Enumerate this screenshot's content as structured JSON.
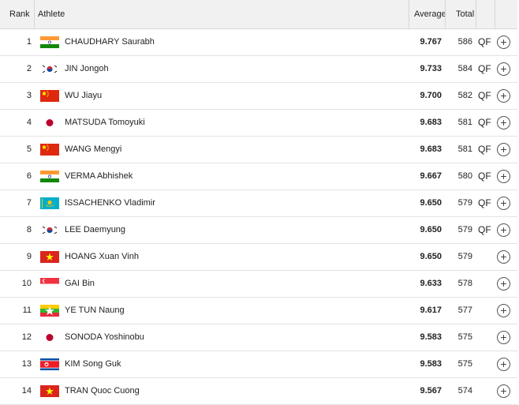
{
  "headers": {
    "rank": "Rank",
    "athlete": "Athlete",
    "average": "Average",
    "total": "Total"
  },
  "flag_colors": {
    "IND": [
      "#FF9933",
      "#FFFFFF",
      "#138808"
    ],
    "KOR": [
      "#FFFFFF",
      "#CD2E3A",
      "#0047A0"
    ],
    "CHN": [
      "#DE2910",
      "#FFDE00"
    ],
    "JPN": [
      "#FFFFFF",
      "#BC002D"
    ],
    "KAZ": [
      "#00AFCA",
      "#FEC50C"
    ],
    "VIE": [
      "#DA251D",
      "#FFFF00"
    ],
    "SGP": [
      "#EF3340",
      "#FFFFFF"
    ],
    "MYA": [
      "#FECB00",
      "#34B233",
      "#EA2839"
    ],
    "PRK": [
      "#024FA2",
      "#ED1C27",
      "#FFFFFF"
    ]
  },
  "expand_icon": "plus-circle-icon",
  "rows": [
    {
      "rank": "1",
      "flag": "IND",
      "athlete": "CHAUDHARY Saurabh",
      "average": "9.767",
      "total": "586",
      "qf": "QF"
    },
    {
      "rank": "2",
      "flag": "KOR",
      "athlete": "JIN Jongoh",
      "average": "9.733",
      "total": "584",
      "qf": "QF"
    },
    {
      "rank": "3",
      "flag": "CHN",
      "athlete": "WU Jiayu",
      "average": "9.700",
      "total": "582",
      "qf": "QF"
    },
    {
      "rank": "4",
      "flag": "JPN",
      "athlete": "MATSUDA Tomoyuki",
      "average": "9.683",
      "total": "581",
      "qf": "QF"
    },
    {
      "rank": "5",
      "flag": "CHN",
      "athlete": "WANG Mengyi",
      "average": "9.683",
      "total": "581",
      "qf": "QF"
    },
    {
      "rank": "6",
      "flag": "IND",
      "athlete": "VERMA Abhishek",
      "average": "9.667",
      "total": "580",
      "qf": "QF"
    },
    {
      "rank": "7",
      "flag": "KAZ",
      "athlete": "ISSACHENKO Vladimir",
      "average": "9.650",
      "total": "579",
      "qf": "QF"
    },
    {
      "rank": "8",
      "flag": "KOR",
      "athlete": "LEE Daemyung",
      "average": "9.650",
      "total": "579",
      "qf": "QF"
    },
    {
      "rank": "9",
      "flag": "VIE",
      "athlete": "HOANG Xuan Vinh",
      "average": "9.650",
      "total": "579",
      "qf": ""
    },
    {
      "rank": "10",
      "flag": "SGP",
      "athlete": "GAI Bin",
      "average": "9.633",
      "total": "578",
      "qf": ""
    },
    {
      "rank": "11",
      "flag": "MYA",
      "athlete": "YE TUN Naung",
      "average": "9.617",
      "total": "577",
      "qf": ""
    },
    {
      "rank": "12",
      "flag": "JPN",
      "athlete": "SONODA Yoshinobu",
      "average": "9.583",
      "total": "575",
      "qf": ""
    },
    {
      "rank": "13",
      "flag": "PRK",
      "athlete": "KIM Song Guk",
      "average": "9.583",
      "total": "575",
      "qf": ""
    },
    {
      "rank": "14",
      "flag": "VIE",
      "athlete": "TRAN Quoc Cuong",
      "average": "9.567",
      "total": "574",
      "qf": ""
    }
  ]
}
